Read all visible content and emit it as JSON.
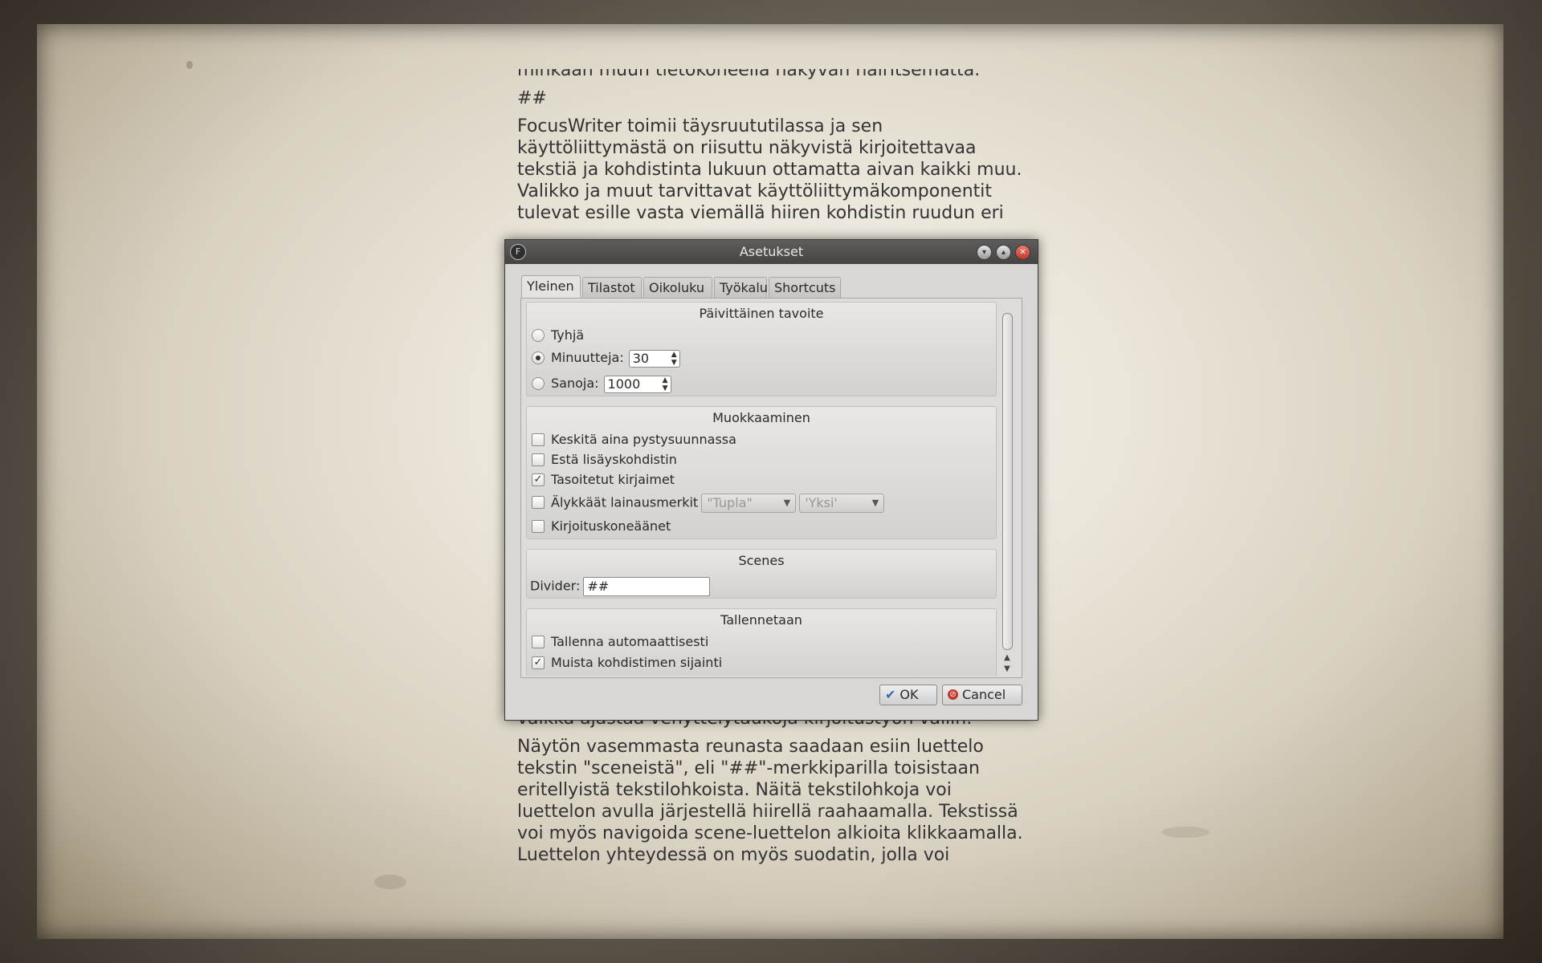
{
  "document": {
    "paragraphs_top": [
      "minkään muun tietokoneella näkyvän häiritsemättä.",
      "##",
      "FocusWriter toimii täysruututilassa ja sen käyttöliittymästä on riisuttu näkyvistä kirjoitettavaa tekstiä ja kohdistinta lukuun ottamatta aivan kaikki muu. Valikko ja muut tarvittavat käyttöliittymäkomponentit tulevat esille vasta viemällä hiiren kohdistin ruudun eri"
    ],
    "paragraphs_bottom": [
      "joilla voidaan asettaa päivittäisiä kirjoitustavoitteita ja vaikka ajastaa venyttelytaukoja kirjoitustyön väliin.",
      "Näytön vasemmasta reunasta saadaan esiin luettelo tekstin \"sceneistä\", eli \"##\"-merkkiparilla toisistaan eritellyistä tekstilohkoista. Näitä tekstilohkoja voi luettelon avulla järjestellä hiirellä raahaamalla. Tekstissä voi myös navigoida scene-luettelon alkioita klikkaamalla. Luettelon yhteydessä on myös suodatin, jolla voi"
    ]
  },
  "dialog": {
    "title": "Asetukset",
    "app_icon_letter": "F",
    "tabs": [
      "Yleinen",
      "Tilastot",
      "Oikoluku",
      "Työkalu",
      "Shortcuts"
    ],
    "active_tab": "Yleinen",
    "daily_goal": {
      "title": "Päivittäinen tavoite",
      "none_label": "Tyhjä",
      "minutes_label": "Minuutteja:",
      "minutes_value": "30",
      "words_label": "Sanoja:",
      "words_value": "1000",
      "selected": "minutes"
    },
    "editing": {
      "title": "Muokkaaminen",
      "center_label": "Keskitä aina pystysuunnassa",
      "block_cursor_label": "Estä lisäyskohdistin",
      "smooth_fonts_label": "Tasoitetut kirjaimet",
      "smart_quotes_label": "Älykkäät lainausmerkit",
      "double_quote_value": "\"Tupla\"",
      "single_quote_value": "'Yksi'",
      "typewriter_label": "Kirjoituskoneäänet",
      "center_checked": false,
      "block_cursor_checked": false,
      "smooth_fonts_checked": true,
      "smart_quotes_checked": false,
      "typewriter_checked": false
    },
    "scenes": {
      "title": "Scenes",
      "divider_label": "Divider:",
      "divider_value": "##"
    },
    "saving": {
      "title": "Tallennetaan",
      "autosave_label": "Tallenna automaattisesti",
      "remember_cursor_label": "Muista kohdistimen sijainti",
      "autosave_checked": false,
      "remember_cursor_checked": true
    },
    "buttons": {
      "ok_label": "OK",
      "cancel_label": "Cancel"
    }
  }
}
